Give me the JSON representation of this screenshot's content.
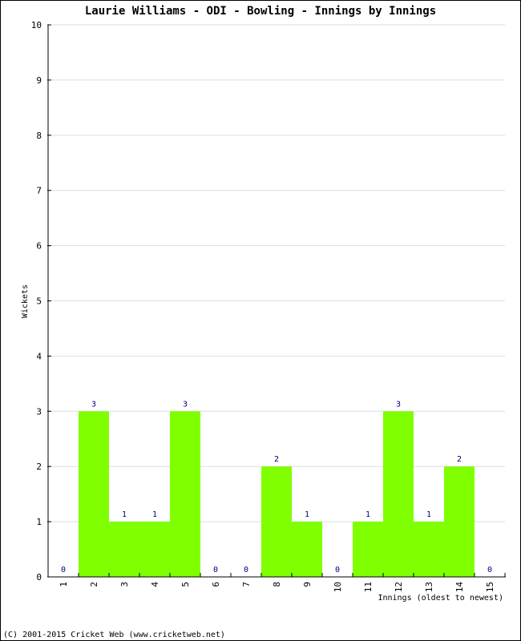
{
  "chart_data": {
    "type": "bar",
    "title": "Laurie Williams - ODI - Bowling - Innings by Innings",
    "xlabel": "Innings (oldest to newest)",
    "ylabel": "Wickets",
    "ylim": [
      0,
      10
    ],
    "yticks": [
      "0",
      "1",
      "2",
      "3",
      "4",
      "5",
      "6",
      "7",
      "8",
      "9",
      "10"
    ],
    "categories": [
      "1",
      "2",
      "3",
      "4",
      "5",
      "6",
      "7",
      "8",
      "9",
      "10",
      "11",
      "12",
      "13",
      "14",
      "15"
    ],
    "values": [
      0,
      3,
      1,
      1,
      3,
      0,
      0,
      2,
      1,
      0,
      1,
      3,
      1,
      2,
      0
    ],
    "data_labels": [
      "0",
      "3",
      "1",
      "1",
      "3",
      "0",
      "0",
      "2",
      "1",
      "0",
      "1",
      "3",
      "1",
      "2",
      "0"
    ],
    "grid": true,
    "bar_color": "#7fff00",
    "label_color": "#000080"
  },
  "footer": "(C) 2001-2015 Cricket Web (www.cricketweb.net)"
}
